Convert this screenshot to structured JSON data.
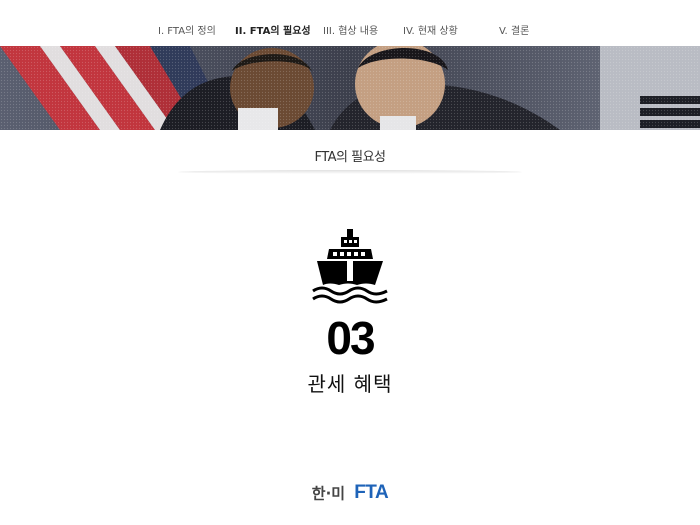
{
  "nav": {
    "items": [
      {
        "label": "I. FTA의 정의"
      },
      {
        "label": "II. FTA의 필요성"
      },
      {
        "label": "III. 협상 내용"
      },
      {
        "label": "IV. 현재 상황"
      },
      {
        "label": "V. 결론"
      }
    ],
    "active_index": 1
  },
  "section": {
    "title": "FTA의 필요성"
  },
  "content": {
    "icon": "ship-icon",
    "number": "03",
    "caption": "관세 혜택"
  },
  "footer": {
    "logo_korean": "한·미",
    "logo_fta": "FTA"
  },
  "colors": {
    "logo_blue": "#1e63b8",
    "logo_red": "#d8232a",
    "active_nav": "#222222"
  }
}
